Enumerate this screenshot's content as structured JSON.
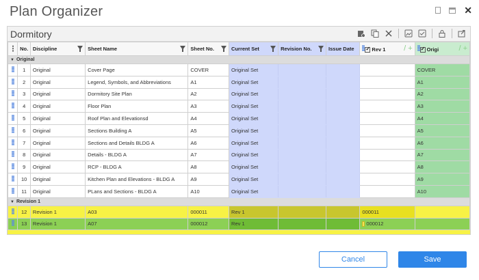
{
  "window": {
    "title": "Plan Organizer"
  },
  "panel": {
    "title": "Dormitory"
  },
  "toolbar": {
    "icons": [
      "add-sheet-icon",
      "copy-icon",
      "delete-icon",
      "image-icon",
      "image-check-icon",
      "lock-icon",
      "share-icon"
    ]
  },
  "columns": {
    "no": "No.",
    "discipline": "Discipline",
    "sheet_name": "Sheet Name",
    "sheet_no": "Sheet No.",
    "current_set": "Current Set",
    "revision_no": "Revision No.",
    "issue_date": "Issue Date",
    "rev1": "Rev 1",
    "original": "Origi"
  },
  "groups": {
    "original": "Original",
    "revision1": "Revision 1"
  },
  "rows_original": [
    {
      "no": "1",
      "discipline": "Original",
      "sheet_name": "Cover Page",
      "sheet_no": "COVER",
      "current_set": "Original Set",
      "orig": "COVER"
    },
    {
      "no": "2",
      "discipline": "Original",
      "sheet_name": "Legend, Symbols, and Abbreviations",
      "sheet_no": "A1",
      "current_set": "Original Set",
      "orig": "A1"
    },
    {
      "no": "3",
      "discipline": "Original",
      "sheet_name": "Dormitory Site Plan",
      "sheet_no": "A2",
      "current_set": "Original Set",
      "orig": "A2"
    },
    {
      "no": "4",
      "discipline": "Original",
      "sheet_name": "Floor Plan",
      "sheet_no": "A3",
      "current_set": "Original Set",
      "orig": "A3"
    },
    {
      "no": "5",
      "discipline": "Original",
      "sheet_name": "Roof Plan and Elevationsd",
      "sheet_no": "A4",
      "current_set": "Original Set",
      "orig": "A4"
    },
    {
      "no": "6",
      "discipline": "Original",
      "sheet_name": "Sections Building A",
      "sheet_no": "A5",
      "current_set": "Original Set",
      "orig": "A5"
    },
    {
      "no": "7",
      "discipline": "Original",
      "sheet_name": "Sections and Details BLDG A",
      "sheet_no": "A6",
      "current_set": "Original Set",
      "orig": "A6"
    },
    {
      "no": "8",
      "discipline": "Original",
      "sheet_name": "Details - BLDG A",
      "sheet_no": "A7",
      "current_set": "Original Set",
      "orig": "A7"
    },
    {
      "no": "9",
      "discipline": "Original",
      "sheet_name": "RCP - BLDG A",
      "sheet_no": "A8",
      "current_set": "Original Set",
      "orig": "A8"
    },
    {
      "no": "10",
      "discipline": "Original",
      "sheet_name": "Kitchen Plan and Elevations - BLDG A",
      "sheet_no": "A9",
      "current_set": "Original Set",
      "orig": "A9"
    },
    {
      "no": "11",
      "discipline": "Original",
      "sheet_name": "PLans and Sections - BLDG A",
      "sheet_no": "A10",
      "current_set": "Original Set",
      "orig": "A10"
    }
  ],
  "rows_revision": [
    {
      "no": "12",
      "discipline": "Revision 1",
      "sheet_name": "A03",
      "sheet_no": "000011",
      "current_set": "Rev 1",
      "rev1": "000011"
    },
    {
      "no": "13",
      "discipline": "Revision 1",
      "sheet_name": "A07",
      "sheet_no": "000012",
      "current_set": "Rev 1",
      "rev1": "000012"
    }
  ],
  "buttons": {
    "cancel": "Cancel",
    "save": "Save"
  },
  "colors": {
    "accent": "#2f86e8",
    "current_set_column": "#cfd8fb",
    "original_column": "#9fdba4",
    "revision_row_1": "#f7f245",
    "revision_row_2": "#8cd055"
  }
}
